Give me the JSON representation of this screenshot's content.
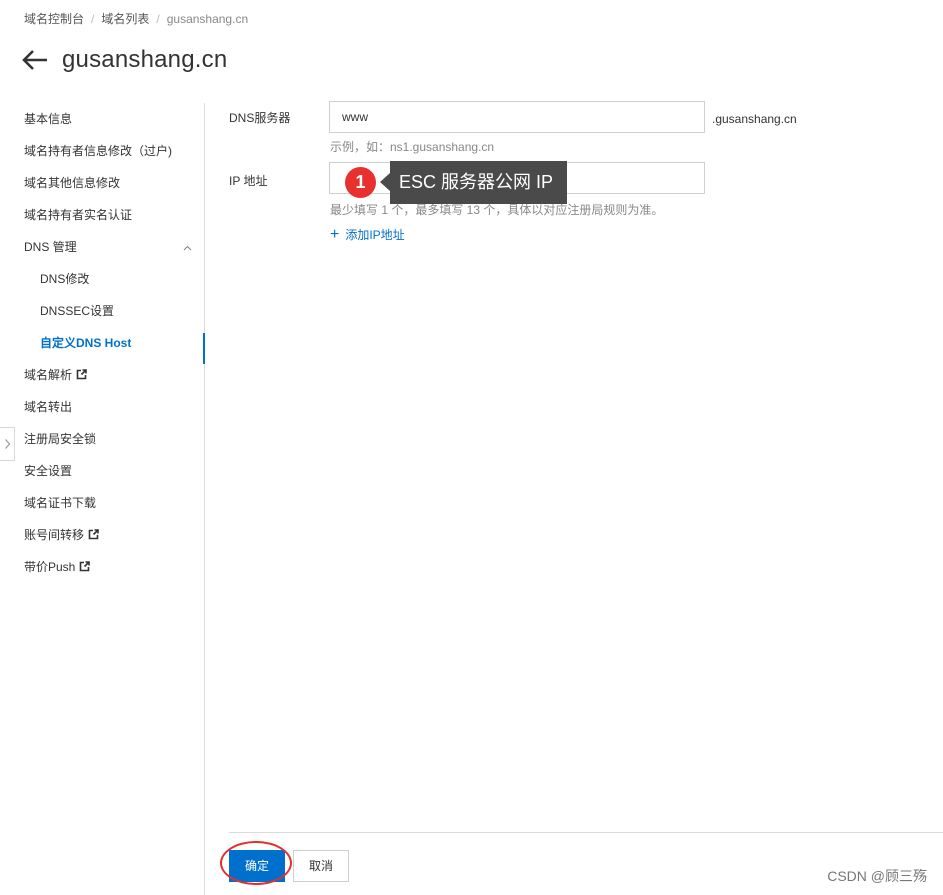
{
  "breadcrumb": {
    "items": [
      "域名控制台",
      "域名列表"
    ],
    "current": "gusanshang.cn"
  },
  "page": {
    "title": "gusanshang.cn"
  },
  "sidebar": {
    "items": [
      {
        "label": "基本信息"
      },
      {
        "label": "域名持有者信息修改（过户)"
      },
      {
        "label": "域名其他信息修改"
      },
      {
        "label": "域名持有者实名认证"
      },
      {
        "label": "DNS 管理"
      },
      {
        "label": "DNS修改"
      },
      {
        "label": "DNSSEC设置"
      },
      {
        "label": "自定义DNS Host"
      },
      {
        "label": "域名解析"
      },
      {
        "label": "域名转出"
      },
      {
        "label": "注册局安全锁"
      },
      {
        "label": "安全设置"
      },
      {
        "label": "域名证书下载"
      },
      {
        "label": "账号间转移"
      },
      {
        "label": "带价Push"
      }
    ]
  },
  "form": {
    "dns_label": "DNS服务器",
    "dns_value": "www",
    "dns_suffix": ".gusanshang.cn",
    "dns_hint": "示例，如：ns1.gusanshang.cn",
    "ip_label": "IP 地址",
    "ip_value": "",
    "ip_hint": "最少填写 1 个，最多填写 13 个，具体以对应注册局规则为准。",
    "add_ip": "添加IP地址"
  },
  "annotation": {
    "step": "1",
    "tooltip": "ESC 服务器公网 IP"
  },
  "actions": {
    "confirm": "确定",
    "cancel": "取消"
  },
  "watermark": "CSDN @顾三殇",
  "colors": {
    "accent": "#0070cc",
    "annotation_red": "#e8312f",
    "tooltip_bg": "#4a4a4a"
  }
}
